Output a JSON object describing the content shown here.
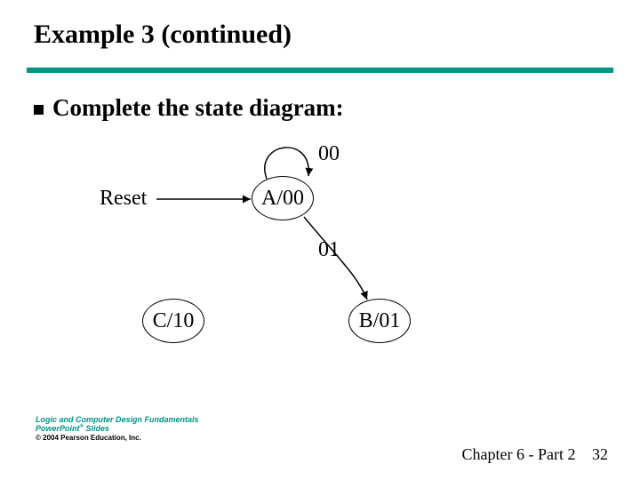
{
  "title": "Example 3 (continued)",
  "bullet": "Complete the state diagram:",
  "diagram": {
    "reset_label": "Reset",
    "states": {
      "A": "A/00",
      "B": "B/01",
      "C": "C/10"
    },
    "edges": {
      "self_loop_A": "00",
      "A_to_B": "01"
    }
  },
  "footer": {
    "logo_line1": "Logic and Computer Design Fundamentals",
    "logo_line2_a": "PowerPoint",
    "logo_line2_sup": "®",
    "logo_line2_b": " Slides",
    "logo_line3": "© 2004 Pearson Education, Inc.",
    "chapter": "Chapter 6 - Part 2",
    "page": "32"
  }
}
